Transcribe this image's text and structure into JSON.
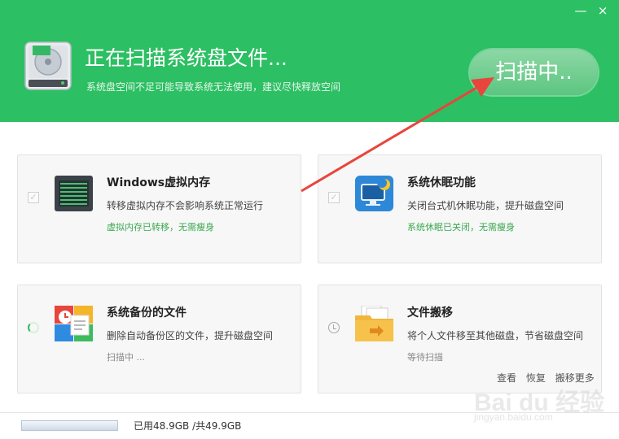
{
  "window": {
    "minimize_glyph": "—",
    "close_glyph": "×"
  },
  "header": {
    "title": "正在扫描系统盘文件...",
    "subtitle": "系统盘空间不足可能导致系统无法使用，建议尽快释放空间",
    "scan_button": "扫描中..",
    "icon": "hard-drive-icon",
    "background_color": "#2dbf63"
  },
  "cards": [
    {
      "title": "Windows虚拟内存",
      "description": "转移虚拟内存不会影响系统正常运行",
      "status": "虚拟内存已转移，无需瘦身",
      "state": "checked",
      "icon": "memory-chip-icon"
    },
    {
      "title": "系统休眠功能",
      "description": "关闭台式机休眠功能，提升磁盘空间",
      "status": "系统休眠已关闭，无需瘦身",
      "state": "checked",
      "icon": "hibernate-monitor-icon"
    },
    {
      "title": "系统备份的文件",
      "description": "删除自动备份区的文件，提升磁盘空间",
      "status": "扫描中 ...",
      "state": "scanning",
      "icon": "backup-files-icon"
    },
    {
      "title": "文件搬移",
      "description": "将个人文件移至其他磁盘，节省磁盘空间",
      "status": "等待扫描",
      "state": "waiting",
      "icon": "folder-move-icon"
    }
  ],
  "links": {
    "view": "查看",
    "restore": "恢复",
    "move_more": "搬移更多"
  },
  "footer": {
    "disk_usage_text": "已用48.9GB /共49.9GB",
    "used_gb": 48.9,
    "total_gb": 49.9
  },
  "watermark": {
    "logo": "Bai du 经验",
    "url": "jingyan.baidu.com"
  },
  "colors": {
    "accent": "#2dbf63",
    "ok_status": "#3aa84f",
    "arrow": "#e8453c"
  }
}
